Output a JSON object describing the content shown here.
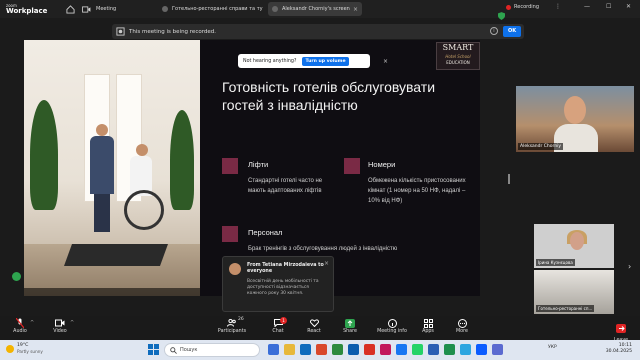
{
  "titlebar": {
    "brand_top": "zoom",
    "brand_bottom": "Workplace",
    "meeting_label": "Meeting",
    "tabs": [
      {
        "label": "Готельно-ресторанні справи та ту"
      },
      {
        "label": "Aleksandr Chorniy's screen"
      }
    ],
    "recording_label": "Recording"
  },
  "banner": {
    "text": "This meeting is being recorded.",
    "ok_label": "OK"
  },
  "slide": {
    "tooltip_text": "Not hearing anything?",
    "tooltip_button": "Turn up volume",
    "logo_line1": "SMART",
    "logo_line2": "Hotel School",
    "logo_line3": "EDUCATION",
    "heading": "Готовність готелів обслуговувати гостей з інвалідністю",
    "features": [
      {
        "title": "Ліфти",
        "desc": "Стандартні готелі часто не мають адаптованих ліфтів"
      },
      {
        "title": "Номери",
        "desc": "Обмежена кількість пристосованих кімнат (1 номер на 50 НФ, надалі – 10% від НФ)"
      },
      {
        "title": "Персонал",
        "desc": "Брак тренінгів з обслуговування людей з інвалідністю"
      }
    ]
  },
  "notification": {
    "from": "From Tetiana Mirzodaieva to everyone",
    "message": "Всесвітній день мобільності та доступності відзначається кожного року 30 квітня."
  },
  "participants": [
    {
      "name": "Aleksandr Chorniy"
    },
    {
      "name": "Ірина Кузнєцова"
    },
    {
      "name": "Готельно-ресторанні сп..."
    }
  ],
  "controls": {
    "audio": "Audio",
    "video": "Video",
    "participants": "Participants",
    "participants_count": "26",
    "chat": "Chat",
    "chat_badge": "1",
    "react": "React",
    "share": "Share",
    "meeting_info": "Meeting info",
    "apps": "Apps",
    "more": "More",
    "leave": "Leave"
  },
  "taskbar": {
    "weather_temp": "19°C",
    "weather_desc": "Partly sunny",
    "search_placeholder": "Пошук",
    "lang": "УКР",
    "time": "10:11",
    "date": "30.04.2025"
  },
  "colors": {
    "accent": "#0e71eb",
    "square": "#7a2a45",
    "recording": "#e02424"
  }
}
